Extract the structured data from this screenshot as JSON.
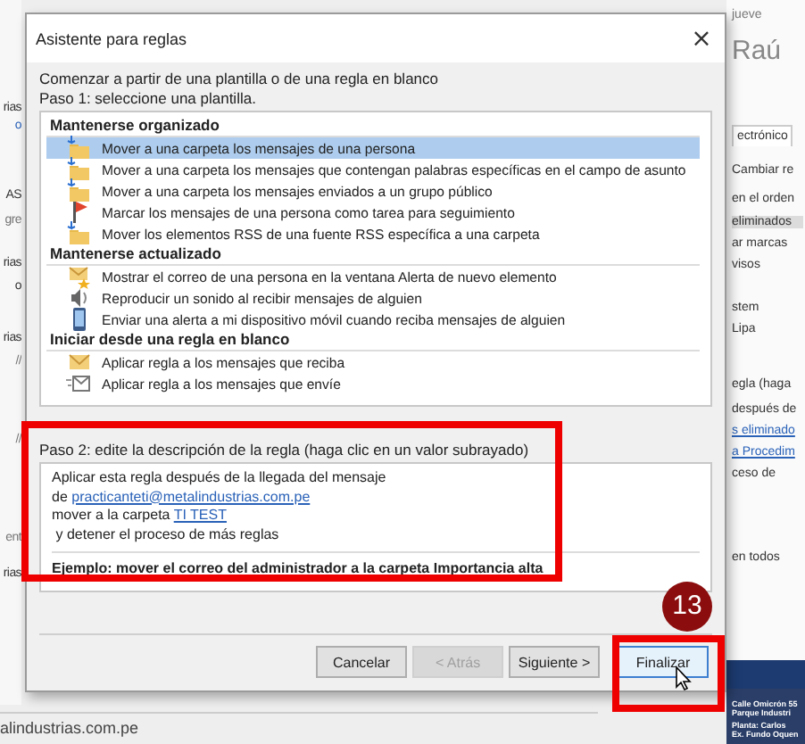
{
  "background": {
    "left_fragments": [
      {
        "text": "rias",
        "kind": "text"
      },
      {
        "text": "o",
        "kind": "link"
      },
      {
        "text": "AS",
        "kind": "text"
      },
      {
        "text": "gre",
        "kind": "muted"
      },
      {
        "text": "rias",
        "kind": "text"
      },
      {
        "text": "o",
        "kind": "text"
      },
      {
        "text": "rias",
        "kind": "text"
      },
      {
        "text": "//",
        "kind": "muted"
      },
      {
        "text": "//",
        "kind": "muted"
      },
      {
        "text": "ent",
        "kind": "muted"
      },
      {
        "text": "rias",
        "kind": "text"
      }
    ],
    "footer_text": "alindustrias.com.pe",
    "right_fragments": [
      {
        "text": "jueve",
        "kind": "muted"
      },
      {
        "text": "Raú",
        "kind": "name"
      },
      {
        "text": "ectrónico",
        "kind": "tab"
      },
      {
        "text": "Cambiar re",
        "kind": "text"
      },
      {
        "text": "en el orden",
        "kind": "text"
      },
      {
        "text": "eliminados",
        "kind": "selected"
      },
      {
        "text": "ar marcas",
        "kind": "text"
      },
      {
        "text": "visos",
        "kind": "text"
      },
      {
        "text": "stem",
        "kind": "text"
      },
      {
        "text": "Lipa",
        "kind": "text"
      },
      {
        "text": "egla (haga",
        "kind": "text"
      },
      {
        "text": "después de",
        "kind": "text"
      },
      {
        "text": "s eliminado",
        "kind": "link"
      },
      {
        "text": "a Procedim",
        "kind": "link"
      },
      {
        "text": "ceso de",
        "kind": "text"
      },
      {
        "text": "en todos",
        "kind": "text"
      },
      {
        "text": "Calle Omicrón 55",
        "kind": "letterhead"
      },
      {
        "text": "Parque Industri",
        "kind": "letterhead"
      },
      {
        "text": "Planta: Carlos",
        "kind": "letterhead"
      },
      {
        "text": "Ex. Fundo Oquen",
        "kind": "letterhead"
      }
    ]
  },
  "dialog": {
    "title": "Asistente para reglas",
    "close": "×",
    "intro": "Comenzar a partir de una plantilla o de una regla en blanco",
    "step1": "Paso 1: seleccione una plantilla.",
    "groups": [
      {
        "heading": "Mantenerse organizado",
        "items": [
          {
            "label": "Mover a una carpeta los mensajes de una persona",
            "kind": "folder",
            "selected": true
          },
          {
            "label": "Mover a una carpeta los mensajes que contengan palabras específicas en el campo de asunto",
            "kind": "folder",
            "selected": false
          },
          {
            "label": "Mover a una carpeta los mensajes enviados a un grupo público",
            "kind": "folder",
            "selected": false
          },
          {
            "label": "Marcar los mensajes de una persona como tarea para seguimiento",
            "kind": "flag",
            "selected": false
          },
          {
            "label": "Mover los elementos RSS de una fuente RSS específica a una carpeta",
            "kind": "folder",
            "selected": false
          }
        ]
      },
      {
        "heading": "Mantenerse actualizado",
        "items": [
          {
            "label": "Mostrar el correo de una persona en la ventana Alerta de nuevo elemento",
            "kind": "alert",
            "selected": false
          },
          {
            "label": "Reproducir un sonido al recibir mensajes de alguien",
            "kind": "speaker",
            "selected": false
          },
          {
            "label": "Enviar una alerta a mi dispositivo móvil cuando reciba mensajes de alguien",
            "kind": "phone",
            "selected": false
          }
        ]
      },
      {
        "heading": "Iniciar desde una regla en blanco",
        "items": [
          {
            "label": "Aplicar regla a los mensajes que reciba",
            "kind": "envelope",
            "selected": false
          },
          {
            "label": "Aplicar regla a los mensajes que envíe",
            "kind": "card",
            "selected": false
          }
        ]
      }
    ],
    "step2": "Paso 2: edite la descripción de la regla (haga clic en un valor subrayado)",
    "description": [
      {
        "text": "Aplicar esta regla después de la llegada del mensaje"
      },
      {
        "text": "de ",
        "link": "practicanteti@metalindustrias.com.pe"
      },
      {
        "text": "mover a la carpeta ",
        "link": "TI TEST"
      },
      {
        "text": " y detener el proceso de más reglas"
      }
    ],
    "example": "Ejemplo: mover el correo del administrador a la carpeta Importancia alta",
    "buttons": [
      {
        "label": "Cancelar",
        "disabled": false,
        "default": false
      },
      {
        "label": "< Atrás",
        "disabled": true,
        "default": false
      },
      {
        "label": "Siguiente >",
        "disabled": false,
        "default": false
      },
      {
        "label": "Finalizar",
        "disabled": false,
        "default": true
      }
    ]
  },
  "annotation": {
    "step_badge": "13"
  }
}
